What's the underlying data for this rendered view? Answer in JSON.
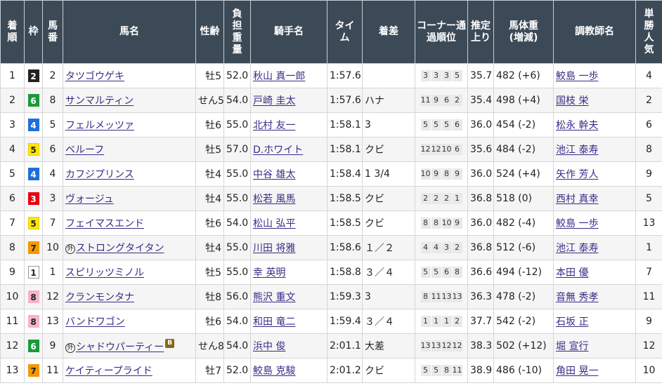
{
  "headers": {
    "chakujun": "着順",
    "waku": "枠",
    "umaban": "馬番",
    "bamei": "馬名",
    "seirei": "性齢",
    "futan": "負担重量",
    "kishu": "騎手名",
    "time": "タイム",
    "chakusa": "着差",
    "corner": "コーナー通過順位",
    "agari": "推定上り",
    "bataiju": "馬体重",
    "bataiju_sub": "(増減)",
    "chokyoshi": "調教師名",
    "ninki": "単勝人気"
  },
  "waku_colors": {
    "1": {
      "bg": "#ffffff",
      "fg": "#222222",
      "border": "#999999"
    },
    "2": {
      "bg": "#222222",
      "fg": "#ffffff",
      "border": "#222222"
    },
    "3": {
      "bg": "#e60012",
      "fg": "#ffffff",
      "border": "#e60012"
    },
    "4": {
      "bg": "#1e6fd9",
      "fg": "#ffffff",
      "border": "#1e6fd9"
    },
    "5": {
      "bg": "#ffe600",
      "fg": "#222222",
      "border": "#e6cf00"
    },
    "6": {
      "bg": "#1a9a3b",
      "fg": "#ffffff",
      "border": "#1a9a3b"
    },
    "7": {
      "bg": "#f39800",
      "fg": "#222222",
      "border": "#f39800"
    },
    "8": {
      "bg": "#f7b3c8",
      "fg": "#222222",
      "border": "#f7b3c8"
    }
  },
  "rows": [
    {
      "chakujun": "1",
      "waku": "2",
      "umaban": "2",
      "mark": "",
      "bamei": "タツゴウゲキ",
      "blinker": "",
      "seirei": "牡5",
      "futan": "52.0",
      "kishu": "秋山 真一郎",
      "time": "1:57.6",
      "chakusa": "",
      "corner": [
        "3",
        "3",
        "3",
        "5"
      ],
      "agari": "35.7",
      "bataiju": "482 (+6)",
      "chokyoshi": "鮫島 一歩",
      "ninki": "4"
    },
    {
      "chakujun": "2",
      "waku": "6",
      "umaban": "8",
      "mark": "",
      "bamei": "サンマルティン",
      "blinker": "",
      "seirei": "せん5",
      "futan": "54.0",
      "kishu": "戸崎 圭太",
      "time": "1:57.6",
      "chakusa": "ハナ",
      "corner": [
        "11",
        "9",
        "6",
        "2"
      ],
      "agari": "35.4",
      "bataiju": "498 (+4)",
      "chokyoshi": "国枝 栄",
      "ninki": "2"
    },
    {
      "chakujun": "3",
      "waku": "4",
      "umaban": "5",
      "mark": "",
      "bamei": "フェルメッツァ",
      "blinker": "",
      "seirei": "牡6",
      "futan": "55.0",
      "kishu": "北村 友一",
      "time": "1:58.1",
      "chakusa": "3",
      "corner": [
        "5",
        "5",
        "5",
        "6"
      ],
      "agari": "36.0",
      "bataiju": "454 (-2)",
      "chokyoshi": "松永 幹夫",
      "ninki": "6"
    },
    {
      "chakujun": "4",
      "waku": "5",
      "umaban": "6",
      "mark": "",
      "bamei": "ベルーフ",
      "blinker": "",
      "seirei": "牡5",
      "futan": "57.0",
      "kishu": "D.ホワイト",
      "time": "1:58.1",
      "chakusa": "クビ",
      "corner": [
        "12",
        "12",
        "10",
        "6"
      ],
      "agari": "35.6",
      "bataiju": "484 (-2)",
      "chokyoshi": "池江 泰寿",
      "ninki": "8"
    },
    {
      "chakujun": "5",
      "waku": "4",
      "umaban": "4",
      "mark": "",
      "bamei": "カフジプリンス",
      "blinker": "",
      "seirei": "牡4",
      "futan": "55.0",
      "kishu": "中谷 雄太",
      "time": "1:58.4",
      "chakusa": "1 3/4",
      "corner": [
        "10",
        "9",
        "8",
        "9"
      ],
      "agari": "36.0",
      "bataiju": "524 (+4)",
      "chokyoshi": "矢作 芳人",
      "ninki": "9"
    },
    {
      "chakujun": "6",
      "waku": "3",
      "umaban": "3",
      "mark": "",
      "bamei": "ヴォージュ",
      "blinker": "",
      "seirei": "牡4",
      "futan": "55.0",
      "kishu": "松若 風馬",
      "time": "1:58.5",
      "chakusa": "クビ",
      "corner": [
        "2",
        "2",
        "2",
        "1"
      ],
      "agari": "36.8",
      "bataiju": "518 (0)",
      "chokyoshi": "西村 真幸",
      "ninki": "5"
    },
    {
      "chakujun": "7",
      "waku": "5",
      "umaban": "7",
      "mark": "",
      "bamei": "フェイマスエンド",
      "blinker": "",
      "seirei": "牡6",
      "futan": "54.0",
      "kishu": "松山 弘平",
      "time": "1:58.5",
      "chakusa": "クビ",
      "corner": [
        "8",
        "8",
        "10",
        "9"
      ],
      "agari": "36.0",
      "bataiju": "482 (-4)",
      "chokyoshi": "鮫島 一歩",
      "ninki": "13"
    },
    {
      "chakujun": "8",
      "waku": "7",
      "umaban": "10",
      "mark": "外",
      "bamei": "ストロングタイタン",
      "blinker": "",
      "seirei": "牡4",
      "futan": "55.0",
      "kishu": "川田 将雅",
      "time": "1:58.6",
      "chakusa": "１／２",
      "corner": [
        "4",
        "4",
        "3",
        "2"
      ],
      "agari": "36.8",
      "bataiju": "512 (-6)",
      "chokyoshi": "池江 泰寿",
      "ninki": "1"
    },
    {
      "chakujun": "9",
      "waku": "1",
      "umaban": "1",
      "mark": "",
      "bamei": "スピリッツミノル",
      "blinker": "",
      "seirei": "牡5",
      "futan": "55.0",
      "kishu": "幸 英明",
      "time": "1:58.8",
      "chakusa": "３／４",
      "corner": [
        "5",
        "5",
        "6",
        "8"
      ],
      "agari": "36.6",
      "bataiju": "494 (-12)",
      "chokyoshi": "本田 優",
      "ninki": "7"
    },
    {
      "chakujun": "10",
      "waku": "8",
      "umaban": "12",
      "mark": "",
      "bamei": "クランモンタナ",
      "blinker": "",
      "seirei": "牡8",
      "futan": "56.0",
      "kishu": "熊沢 重文",
      "time": "1:59.3",
      "chakusa": "3",
      "corner": [
        "8",
        "11",
        "13",
        "13"
      ],
      "agari": "36.3",
      "bataiju": "478 (-2)",
      "chokyoshi": "音無 秀孝",
      "ninki": "11"
    },
    {
      "chakujun": "11",
      "waku": "8",
      "umaban": "13",
      "mark": "",
      "bamei": "バンドワゴン",
      "blinker": "",
      "seirei": "牡6",
      "futan": "54.0",
      "kishu": "和田 竜二",
      "time": "1:59.4",
      "chakusa": "３／４",
      "corner": [
        "1",
        "1",
        "1",
        "2"
      ],
      "agari": "37.7",
      "bataiju": "542 (-2)",
      "chokyoshi": "石坂 正",
      "ninki": "9"
    },
    {
      "chakujun": "12",
      "waku": "6",
      "umaban": "9",
      "mark": "外",
      "bamei": "シャドウパーティー",
      "blinker": "B",
      "seirei": "せん8",
      "futan": "54.0",
      "kishu": "浜中 俊",
      "time": "2:01.1",
      "chakusa": "大差",
      "corner": [
        "13",
        "13",
        "12",
        "12"
      ],
      "agari": "38.3",
      "bataiju": "502 (+12)",
      "chokyoshi": "堀 宣行",
      "ninki": "12"
    },
    {
      "chakujun": "13",
      "waku": "7",
      "umaban": "11",
      "mark": "",
      "bamei": "ケイティープライド",
      "blinker": "",
      "seirei": "牡7",
      "futan": "52.0",
      "kishu": "鮫島 克駿",
      "time": "2:01.2",
      "chakusa": "クビ",
      "corner": [
        "5",
        "5",
        "8",
        "11"
      ],
      "agari": "38.9",
      "bataiju": "486 (-10)",
      "chokyoshi": "角田 晃一",
      "ninki": "10"
    }
  ]
}
